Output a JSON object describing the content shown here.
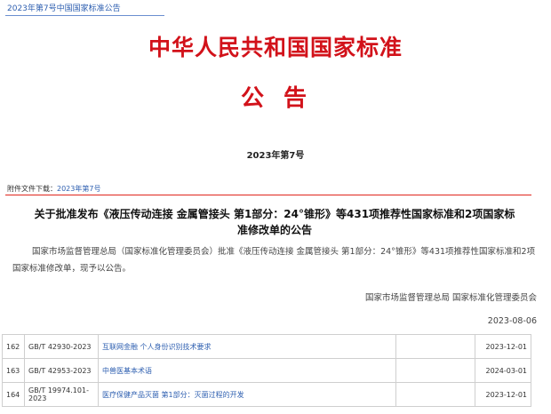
{
  "breadcrumb": "2023年第7号中国国家标准公告",
  "document": {
    "title": "中华人民共和国国家标准",
    "subtitle": "公告",
    "issue_no": "2023年第7号"
  },
  "attachment": {
    "label": "附件文件下载：",
    "link": "2023年第7号"
  },
  "notice": {
    "heading_line1": "关于批准发布《液压传动连接 金属管接头 第1部分：24°锥形》等431项推荐性国家标准和2项国家标",
    "heading_line2": "准修改单的公告",
    "body": "国家市场监督管理总局（国家标准化管理委员会）批准《液压传动连接 金属管接头 第1部分：24°锥形》等431项推荐性国家标准和2项国家标准修改单，现予以公告。",
    "signature": "国家市场监督管理总局  国家标准化管理委员会",
    "date": "2023-08-06"
  },
  "table": {
    "rows": [
      {
        "seq": "162",
        "code": "GB/T 42930-2023",
        "name": "互联网金融 个人身份识别技术要求",
        "date": "2023-12-01"
      },
      {
        "seq": "163",
        "code": "GB/T 42953-2023",
        "name": "中兽医基本术语",
        "date": "2024-03-01"
      },
      {
        "seq": "164",
        "code": "GB/T 19974.101-2023",
        "name": "医疗保健产品灭菌 第1部分：灭菌过程的开发",
        "date": "2023-12-01"
      }
    ]
  }
}
